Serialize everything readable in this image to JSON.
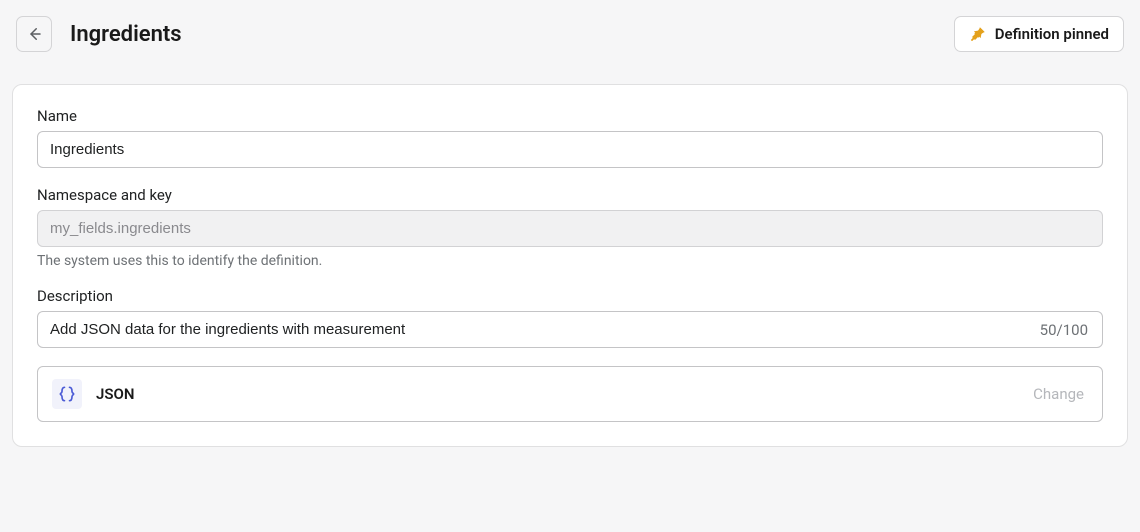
{
  "header": {
    "title": "Ingredients",
    "pinned_label": "Definition pinned"
  },
  "form": {
    "name": {
      "label": "Name",
      "value": "Ingredients"
    },
    "namespace": {
      "label": "Namespace and key",
      "value": "my_fields.ingredients",
      "helper": "The system uses this to identify the definition."
    },
    "description": {
      "label": "Description",
      "value": "Add JSON data for the ingredients with measurement",
      "count": "50/100"
    },
    "type": {
      "label": "JSON",
      "change": "Change"
    }
  }
}
